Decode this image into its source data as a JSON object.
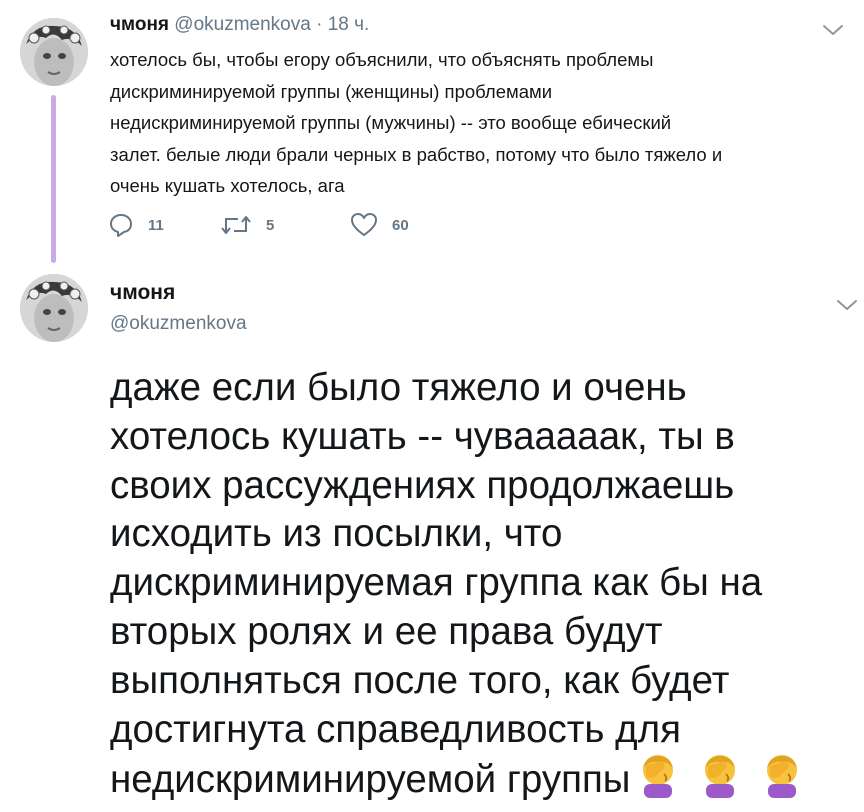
{
  "tweet1": {
    "author_name": "чмоня",
    "author_handle": "@okuzmenkova",
    "separator": "·",
    "time": "18 ч.",
    "text_lines": [
      "хотелось бы, чтобы егору объяснили, что объяснять проблемы",
      "дискриминируемой группы (женщины) проблемами",
      "недискриминируемой группы (мужчины) -- это вообще ебический",
      "залет. белые люди брали черных в рабство, потому что было тяжело и",
      "очень кушать хотелось, ага"
    ],
    "replies": "11",
    "retweets": "5",
    "likes": "60"
  },
  "tweet2": {
    "author_name": "чмоня",
    "author_handle": "@okuzmenkova",
    "text_lines": [
      "даже если было тяжело и очень",
      "хотелось кушать -- чувааааак, ты в",
      "своих рассуждениях продолжаешь",
      "исходить из посылки, что",
      "дискриминируемая группа как бы на",
      "вторых ролях и ее права будут",
      "выполняться после того, как будет",
      "достигнута справедливость для",
      "недискриминируемой группы"
    ],
    "trailing_emoji": [
      "facepalm-emoji",
      "facepalm-emoji",
      "facepalm-emoji"
    ]
  },
  "icons": {
    "reply": "reply-icon",
    "retweet": "retweet-icon",
    "like": "heart-icon",
    "menu": "chevron-down-icon"
  },
  "colors": {
    "text": "#14171a",
    "muted": "#657786",
    "thread_line": "#c9a9e6",
    "emoji_skin": "#f7c23c",
    "emoji_sleeve": "#9b59c9"
  }
}
